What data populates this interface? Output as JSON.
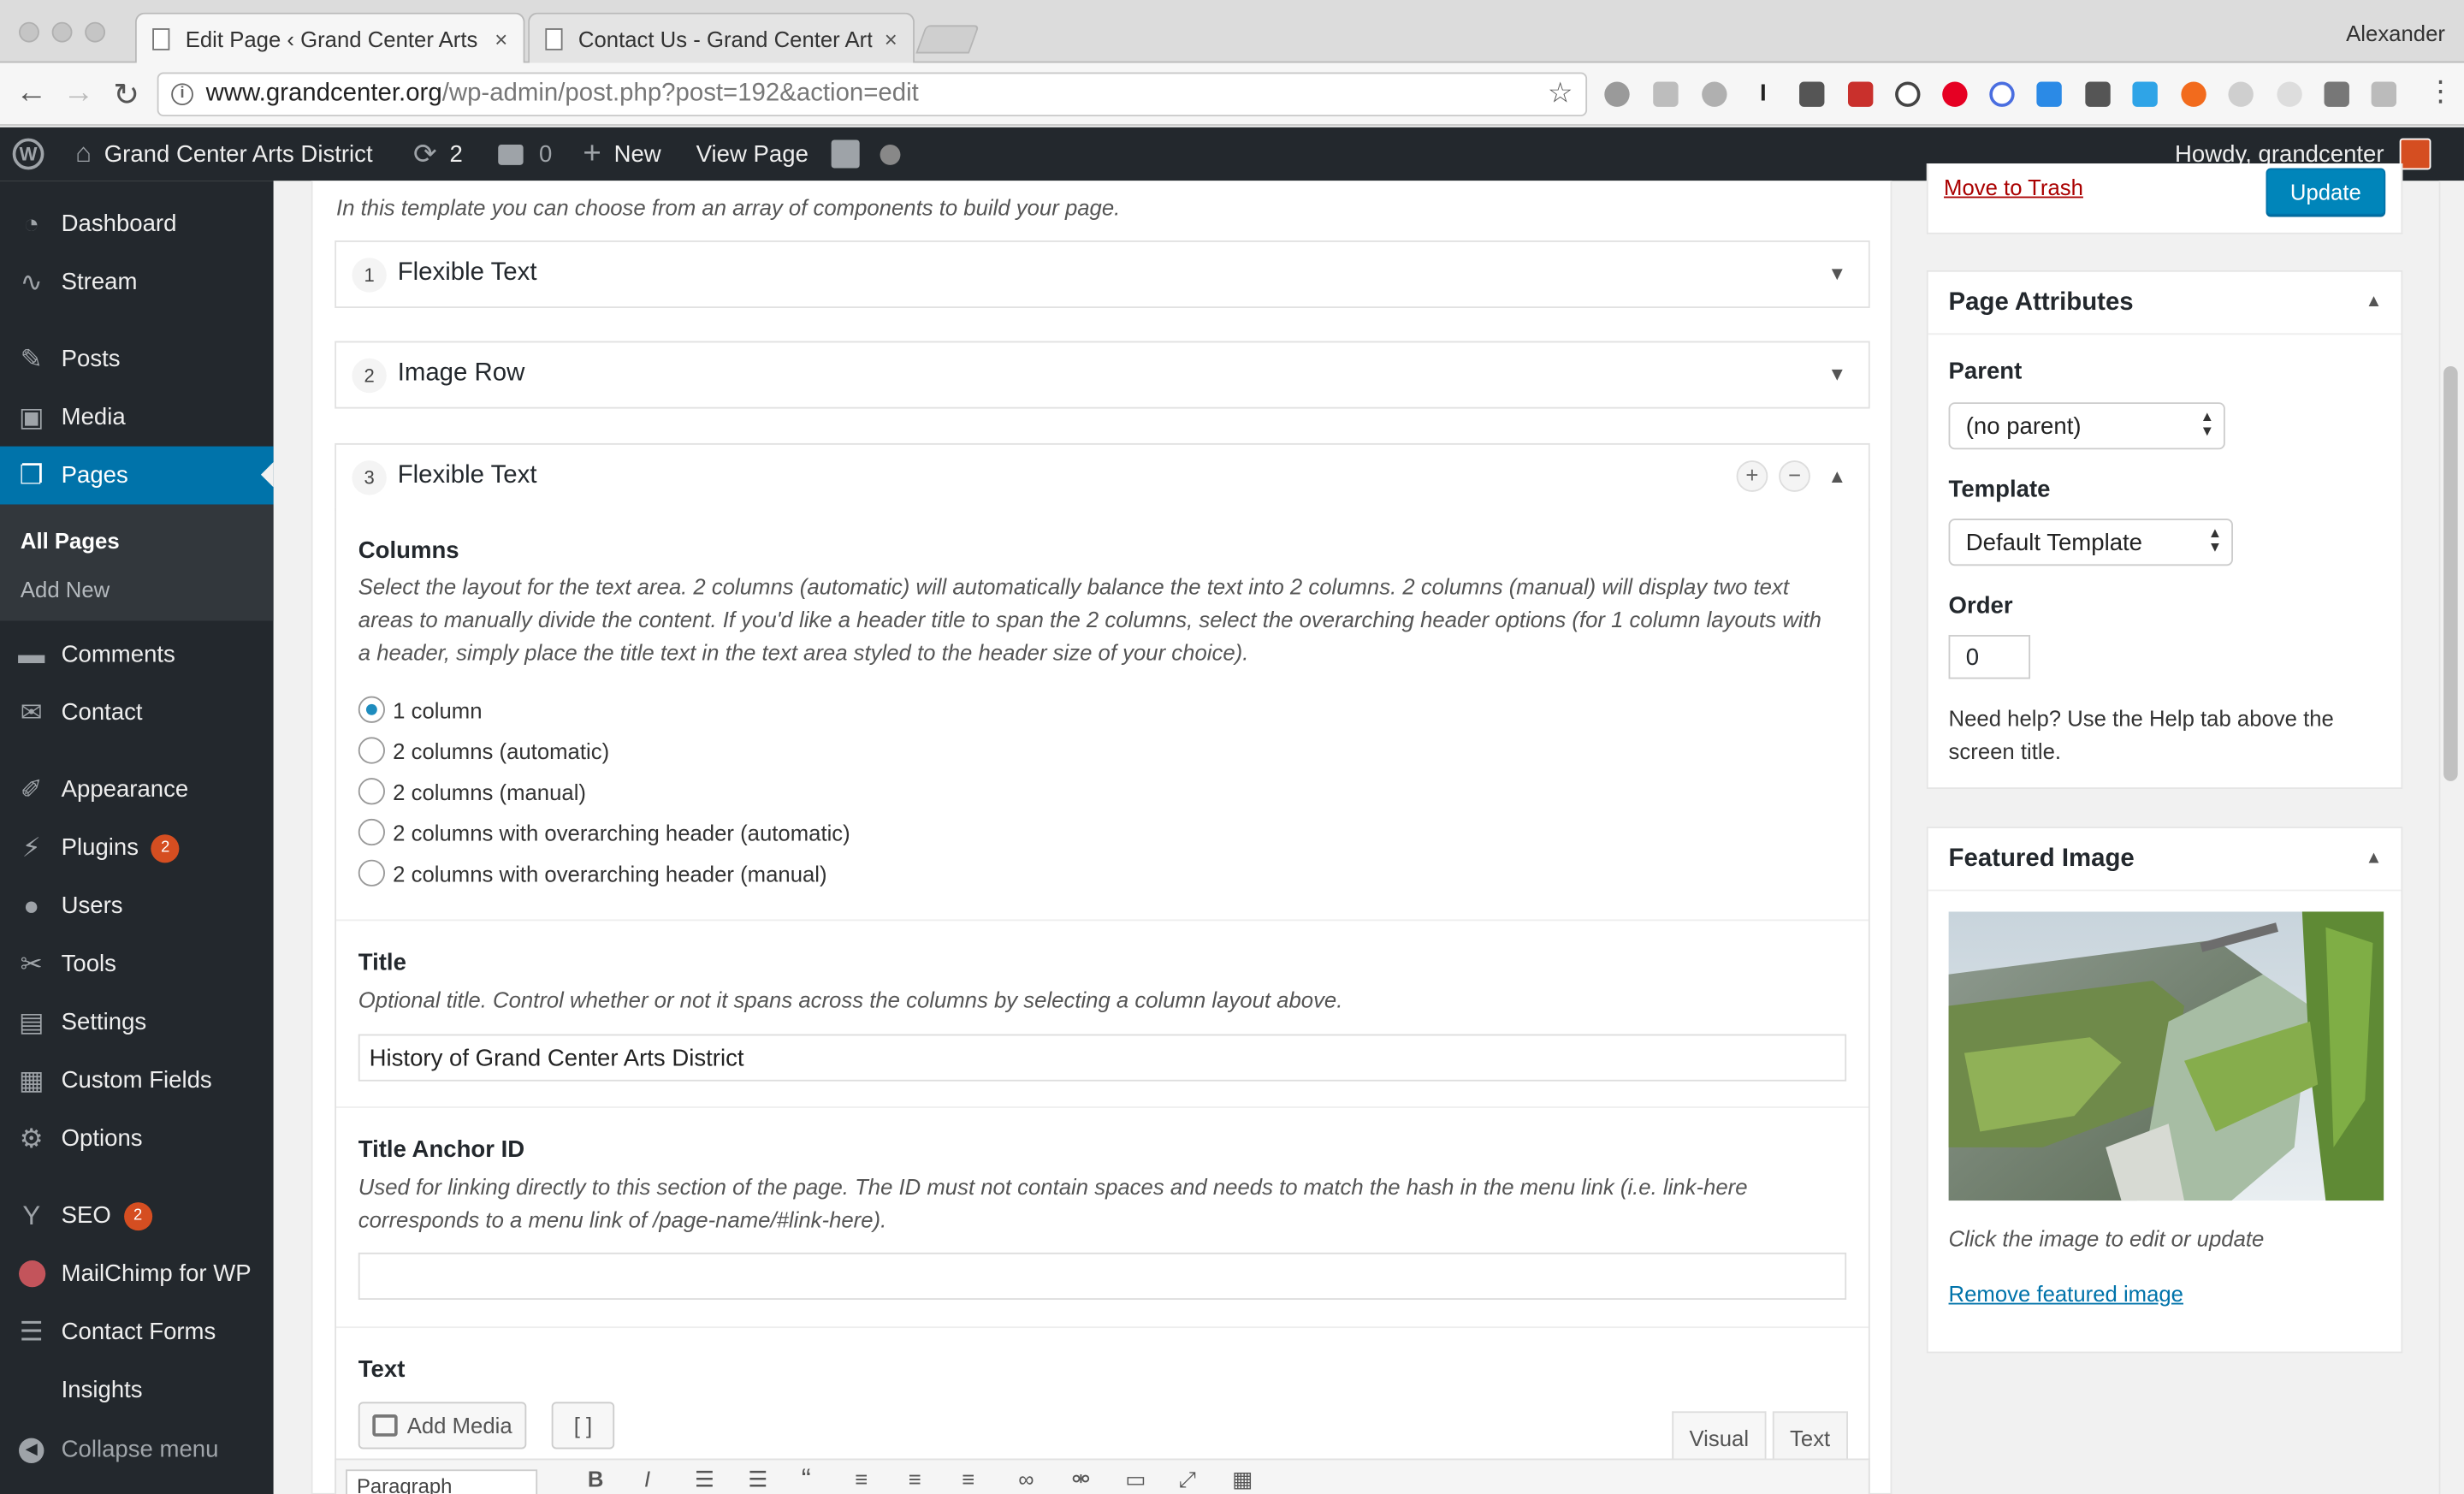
{
  "browser": {
    "tabs": [
      {
        "title": "Edit Page ‹ Grand Center Arts",
        "close": "×"
      },
      {
        "title": "Contact Us - Grand Center Art",
        "close": "×"
      }
    ],
    "profile": "Alexander",
    "url_domain": "www.grandcenter.org",
    "url_path": "/wp-admin/post.php?post=192&action=edit"
  },
  "adminbar": {
    "site_name": "Grand Center Arts District",
    "updates": "2",
    "comments": "0",
    "new_label": "New",
    "view_label": "View Page",
    "greeting": "Howdy, grandcenter"
  },
  "sidebar": {
    "items": [
      {
        "label": "Dashboard",
        "icon": "dashboard-icon"
      },
      {
        "label": "Stream",
        "icon": "stream-icon"
      },
      {
        "label": "Posts",
        "icon": "pin-icon"
      },
      {
        "label": "Media",
        "icon": "media-icon"
      },
      {
        "label": "Pages",
        "icon": "pages-icon"
      },
      {
        "label": "Comments",
        "icon": "comments-icon"
      },
      {
        "label": "Contact",
        "icon": "mail-icon"
      },
      {
        "label": "Appearance",
        "icon": "brush-icon"
      },
      {
        "label": "Plugins",
        "icon": "plugin-icon",
        "badge": "2"
      },
      {
        "label": "Users",
        "icon": "users-icon"
      },
      {
        "label": "Tools",
        "icon": "tools-icon"
      },
      {
        "label": "Settings",
        "icon": "settings-icon"
      },
      {
        "label": "Custom Fields",
        "icon": "fields-icon"
      },
      {
        "label": "Options",
        "icon": "gear-icon"
      },
      {
        "label": "SEO",
        "icon": "seo-icon",
        "badge": "2"
      },
      {
        "label": "MailChimp for WP",
        "icon": "mailchimp-icon"
      },
      {
        "label": "Contact Forms",
        "icon": "forms-icon"
      },
      {
        "label": "Insights",
        "icon": ""
      },
      {
        "label": "Collapse menu",
        "icon": "collapse-icon"
      }
    ],
    "submenu": [
      "All Pages",
      "Add New"
    ]
  },
  "main": {
    "intro": "In this template you can choose from an array of components to build your page.",
    "layouts": [
      {
        "num": "1",
        "name": "Flexible Text"
      },
      {
        "num": "2",
        "name": "Image Row"
      },
      {
        "num": "3",
        "name": "Flexible Text"
      }
    ],
    "columns": {
      "label": "Columns",
      "instructions": "Select the layout for the text area. 2 columns (automatic) will automatically balance the text into 2 columns. 2 columns (manual) will display two text areas to manually divide the content. If you'd like a header title to span the 2 columns, select the overarching header options (for 1 column layouts with a header, simply place the title text in the text area styled to the header size of your choice).",
      "options": [
        "1 column",
        "2 columns (automatic)",
        "2 columns (manual)",
        "2 columns with overarching header (automatic)",
        "2 columns with overarching header (manual)"
      ],
      "selected": "1 column"
    },
    "title_field": {
      "label": "Title",
      "instructions": "Optional title. Control whether or not it spans across the columns by selecting a column layout above.",
      "value": "History of Grand Center Arts District"
    },
    "anchor_field": {
      "label": "Title Anchor ID",
      "instructions": "Used for linking directly to this section of the page. The ID must not contain spaces and needs to match the hash in the menu link (i.e. link-here corresponds to a menu link of /page-name/#link-here).",
      "value": ""
    },
    "text_field": {
      "label": "Text",
      "add_media": "Add Media",
      "shortcode": "[ ]",
      "tab_visual": "Visual",
      "tab_text": "Text",
      "format": "Paragraph"
    }
  },
  "publish": {
    "trash": "Move to Trash",
    "update": "Update"
  },
  "page_attributes": {
    "title": "Page Attributes",
    "parent_label": "Parent",
    "parent_value": "(no parent)",
    "template_label": "Template",
    "template_value": "Default Template",
    "order_label": "Order",
    "order_value": "0",
    "help": "Need help? Use the Help tab above the screen title."
  },
  "featured_image": {
    "title": "Featured Image",
    "caption": "Click the image to edit or update",
    "remove": "Remove featured image"
  }
}
